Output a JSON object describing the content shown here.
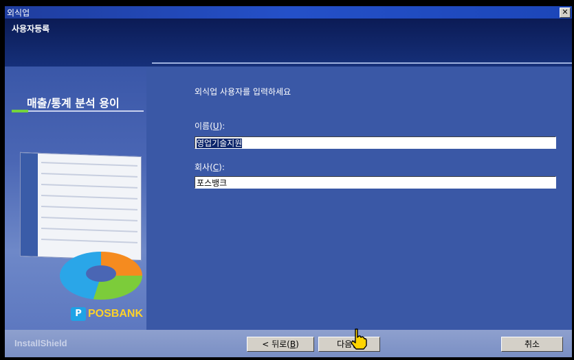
{
  "window": {
    "title": "외식업"
  },
  "header": {
    "title": "사용자등록"
  },
  "left_panel": {
    "promo": "매출/통계 분석 용이",
    "logo_text": "POSBANK"
  },
  "content": {
    "prompt": "외식업 사용자를 입력하세요",
    "name_label": "이름(",
    "name_hotkey": "U",
    "name_label_end": "):",
    "name_value": "영업기술지원",
    "company_label": "회사(",
    "company_hotkey": "C",
    "company_label_end": "):",
    "company_value": "포스뱅크"
  },
  "footer": {
    "brand": "InstallShield",
    "back_prefix": "< 뒤로(",
    "back_hotkey": "B",
    "back_suffix": ")",
    "next_label": "다음(N",
    "cancel_label": "취소"
  }
}
